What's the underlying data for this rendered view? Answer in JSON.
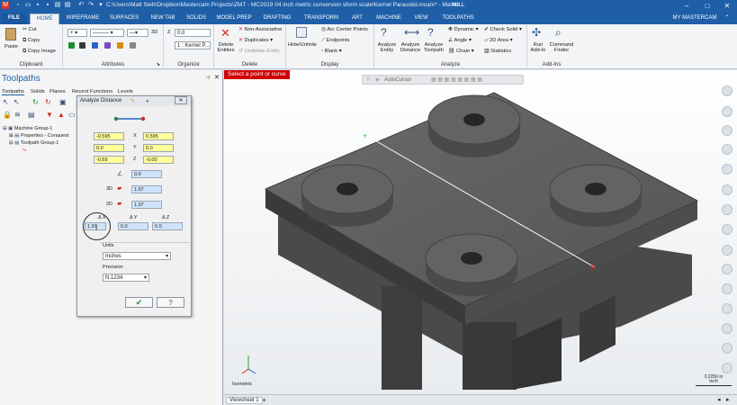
{
  "window": {
    "title": "C:\\Users\\Matt Sieh\\Dropbox\\Mastercam Projects\\ZMT - MC2019 04 inch metric conversion sform scale\\Kernel Parasolid.mcam* - Master...",
    "context": "MILL"
  },
  "tabs": [
    "FILE",
    "HOME",
    "WIREFRAME",
    "SURFACES",
    "NEW TAB",
    "SOLIDS",
    "MODEL PREP",
    "DRAFTING",
    "TRANSFORM",
    "ART",
    "MACHINE",
    "VIEW",
    "TOOLPATHS"
  ],
  "account": "MY MASTERCAM",
  "ribbon": {
    "clipboard": {
      "paste": "Paste",
      "cut": "Cut",
      "copy": "Copy",
      "copy_image": "Copy Image",
      "label": "Clipboard"
    },
    "attributes": {
      "label": "Attributes",
      "three_d": "3D"
    },
    "organize": {
      "z_label": "Z",
      "z_value": "0.0",
      "level": "1 : Kernel P...",
      "label": "Organize"
    },
    "delete": {
      "delete_entities": "Delete Entities",
      "non_assoc": "Non-Associative",
      "duplicates": "Duplicates",
      "undelete": "Undelete Entity",
      "label": "Delete"
    },
    "display": {
      "hide": "Hide/Unhide",
      "arc_center": "Arc Center Points",
      "endpoints": "Endpoints",
      "blank": "Blank",
      "label": "Display"
    },
    "analyze": {
      "entity": "Analyze Entity",
      "distance": "Analyze Distance",
      "toolpath": "Analyze Toolpath",
      "dynamic": "Dynamic",
      "angle": "Angle",
      "chain": "Chain",
      "check_solid": "Check Solid",
      "area": "2D Area",
      "statistics": "Statistics",
      "label": "Analyze"
    },
    "addins": {
      "run": "Run Add-In",
      "finder": "Command Finder",
      "label": "Add-Ins"
    }
  },
  "left_panel": {
    "title": "Toolpaths",
    "tabs": [
      "Toolpaths",
      "Solids",
      "Planes",
      "Recent Functions",
      "Levels"
    ],
    "tree": [
      "Machine Group-1",
      "Properties - Conquest",
      "Toolpath Group-1"
    ]
  },
  "dialog": {
    "title": "Analyze Distance",
    "p1": {
      "x": "-0.595",
      "y": "0.0",
      "z": "-0.69"
    },
    "p2": {
      "x": "0.595",
      "y": "0.0",
      "z": "-0.00"
    },
    "axis_labels": {
      "x": "X",
      "y": "Y",
      "z": "Z"
    },
    "angle": "0.0",
    "d3_label": "3D",
    "d3": "1.97",
    "d2_label": "2D",
    "d2": "1.97",
    "delta_labels": {
      "x": "Δ X",
      "y": "Δ Y",
      "z": "Δ Z"
    },
    "dx": "1.97",
    "dy": "0.0",
    "dz": "0.0",
    "units_label": "Units",
    "units": "Inches",
    "precision_label": "Precision",
    "precision": "N.1234"
  },
  "viewport": {
    "prompt": "Select a point or curve",
    "autocursor": "AutoCursor",
    "view_label": "Isometric",
    "scale_value": "0.2256 in",
    "scale_unit": "Inch"
  },
  "statusbar": {
    "viewsheet": "Viewsheet 1"
  }
}
